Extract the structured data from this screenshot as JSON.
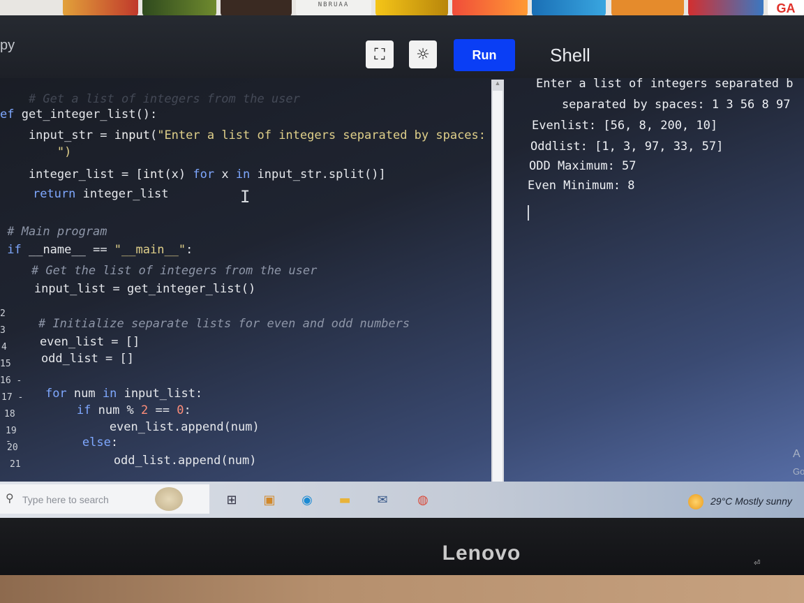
{
  "ad_strip": {
    "thumb_text": "NBRUAA",
    "game_text": "GA"
  },
  "toolbar": {
    "file_tab": "py",
    "fullscreen_icon": "fullscreen-icon",
    "theme_icon": "sun-icon",
    "run_label": "Run",
    "shell_title": "Shell"
  },
  "editor": {
    "line_numbers": [
      "2",
      "3",
      "4",
      "15",
      "16 -",
      "17 -",
      "18",
      "19 -",
      "20",
      "21"
    ],
    "lines": [
      {
        "html": "<span class=\"cm\">    # Get a list of integers from the user</span>"
      },
      {
        "html": "<span class=\"kw\">ef</span> get_integer_list():"
      },
      {
        "html": "    input_str = <span class=\"fn\">input</span>(<span class=\"str\">\"Enter a list of integers separated by spaces:</span>"
      },
      {
        "html": "<span class=\"str\">        \")</span>"
      },
      {
        "html": "    integer_list = [<span class=\"fn\">int</span>(x) <span class=\"kw\">for</span> x <span class=\"kw\">in</span> input_str.split()]"
      },
      {
        "html": "    <span class=\"kw\">return</span> integer_list"
      },
      {
        "html": "<span class=\"cm\"> # Main program</span>"
      },
      {
        "html": " <span class=\"kw\">if</span> __name__ == <span class=\"str\">\"__main__\"</span>:"
      },
      {
        "html": "<span class=\"cm\">    # Get the list of integers from the user</span>"
      },
      {
        "html": "    input_list = get_integer_list()"
      },
      {
        "html": "<span class=\"cm\">    # Initialize separate lists for even and odd numbers</span>"
      },
      {
        "html": "    even_list = []"
      },
      {
        "html": "    odd_list = []"
      },
      {
        "html": "    <span class=\"kw\">for</span> num <span class=\"kw\">in</span> input_list:"
      },
      {
        "html": "        <span class=\"kw\">if</span> num % <span class=\"num\">2</span> == <span class=\"num\">0</span>:"
      },
      {
        "html": "            even_list.append(num)"
      },
      {
        "html": "        <span class=\"kw\">else</span>:"
      },
      {
        "html": "            odd_list.append(num)"
      }
    ]
  },
  "shell": {
    "lines": [
      "Enter a list of integers separated b",
      "    separated by spaces: 1 3 56 8 97",
      "Evenlist: [56, 8, 200, 10]",
      "Oddlist: [1, 3, 97, 33, 57]",
      "ODD Maximum: 57",
      "Even Minimum: 8"
    ],
    "watermark_1": "A",
    "watermark_2": "Go"
  },
  "taskbar": {
    "search_placeholder": "Type here to search",
    "icons": [
      "task-view-icon",
      "store-icon",
      "edge-icon",
      "file-explorer-icon",
      "mail-icon",
      "chrome-icon"
    ],
    "weather": "29°C  Mostly sunny"
  },
  "monitor": {
    "brand": "Lenovo"
  }
}
